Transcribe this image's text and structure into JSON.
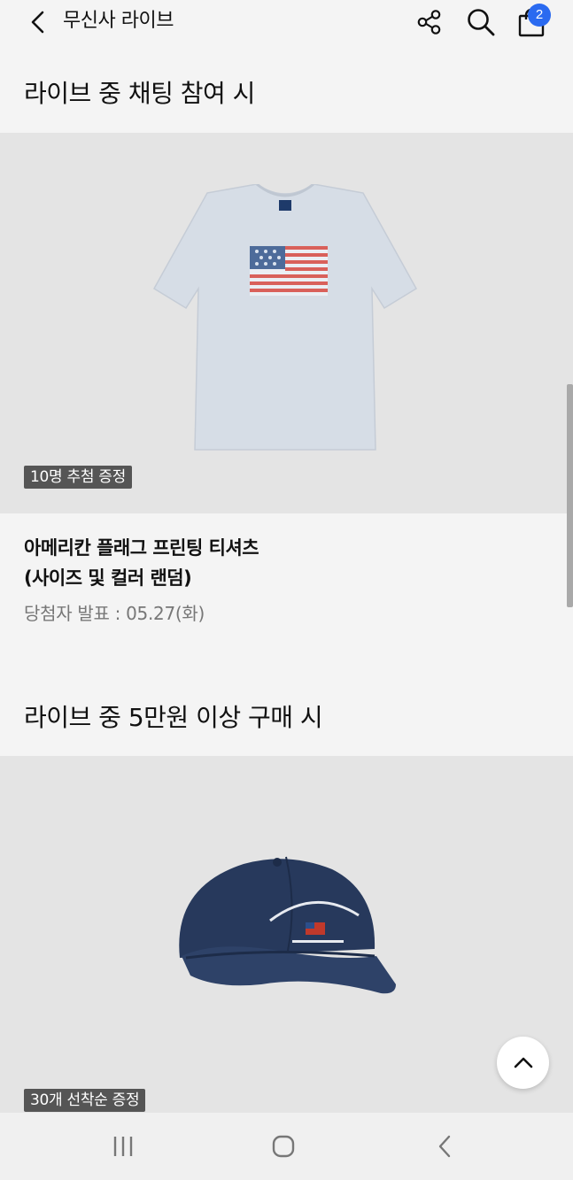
{
  "header": {
    "title": "무신사 라이브",
    "back_icon": "chevron-left-icon",
    "share_icon": "share-icon",
    "search_icon": "search-icon",
    "bag_icon": "shopping-bag-icon",
    "cart_count": "2",
    "badge_color": "#2a6af0"
  },
  "sections": [
    {
      "title": "라이브 중 채팅 참여 시",
      "badge": "10명 추첨 증정",
      "product_name_line1": "아메리칸 플래그 프린팅 티셔츠",
      "product_name_line2": "(사이즈 및 컬러 랜덤)",
      "announce": "당첨자 발표 : 05.27(화)"
    },
    {
      "title": "라이브 중 5만원 이상 구매 시",
      "badge": "30개 선착순 증정"
    }
  ],
  "scroll_top_icon": "chevron-up-icon",
  "nav": {
    "recent_icon": "recent-apps-icon",
    "home_icon": "home-icon",
    "back_icon": "back-icon"
  }
}
